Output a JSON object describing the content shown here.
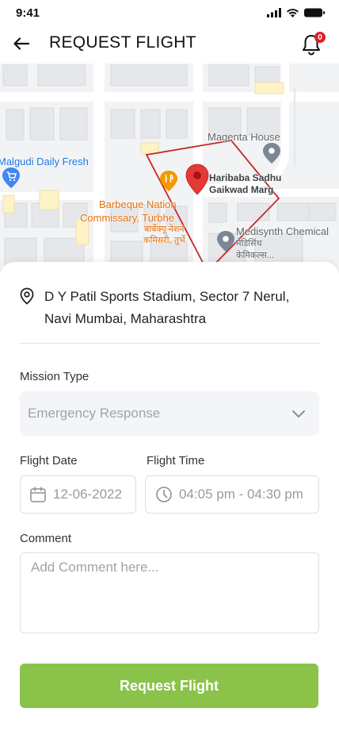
{
  "status_bar": {
    "time": "9:41"
  },
  "header": {
    "title": "REQUEST FLIGHT",
    "notification_count": "0"
  },
  "map": {
    "labels": {
      "magenta_house": "Magenta House",
      "malgudi": "Malgudi Daily Fresh",
      "haribaba_line1": "Haribaba Sadhu",
      "haribaba_line2": "Gaikwad Marg",
      "barbeque_line1": "Barbeque Nation",
      "barbeque_line2": "Commissary, Turbhe",
      "barbeque_line3": "बार्बेक्यू नेशन",
      "barbeque_line4": "कमिसरी, तुर्भे",
      "medisynth_line1": "Medisynth Chemical",
      "medisynth_line2": "मेडिसिंथ",
      "medisynth_line3": "केमिकल्स..."
    },
    "colors": {
      "boundary": "#c62828",
      "marker": "#e53935",
      "poi_gray": "#7b8794",
      "poi_orange": "#f29900",
      "poi_blue": "#4285f4"
    }
  },
  "location": {
    "line1": "D Y Patil Sports Stadium, Sector 7 Nerul,",
    "line2": "Navi Mumbai, Maharashtra"
  },
  "form": {
    "mission_type_label": "Mission Type",
    "mission_type_value": "Emergency Response",
    "flight_date_label": "Flight Date",
    "flight_date_value": "12-06-2022",
    "flight_time_label": "Flight Time",
    "flight_time_value": "04:05 pm - 04:30 pm",
    "comment_label": "Comment",
    "comment_placeholder": "Add Comment here...",
    "comment_value": ""
  },
  "submit": {
    "label": "Request Flight",
    "color": "#8bc34a"
  },
  "icons": [
    "back-arrow-icon",
    "bell-icon",
    "location-pin-icon",
    "chevron-down-icon",
    "calendar-icon",
    "clock-icon",
    "map-marker-icon",
    "restaurant-icon",
    "shopping-cart-icon",
    "place-icon"
  ]
}
